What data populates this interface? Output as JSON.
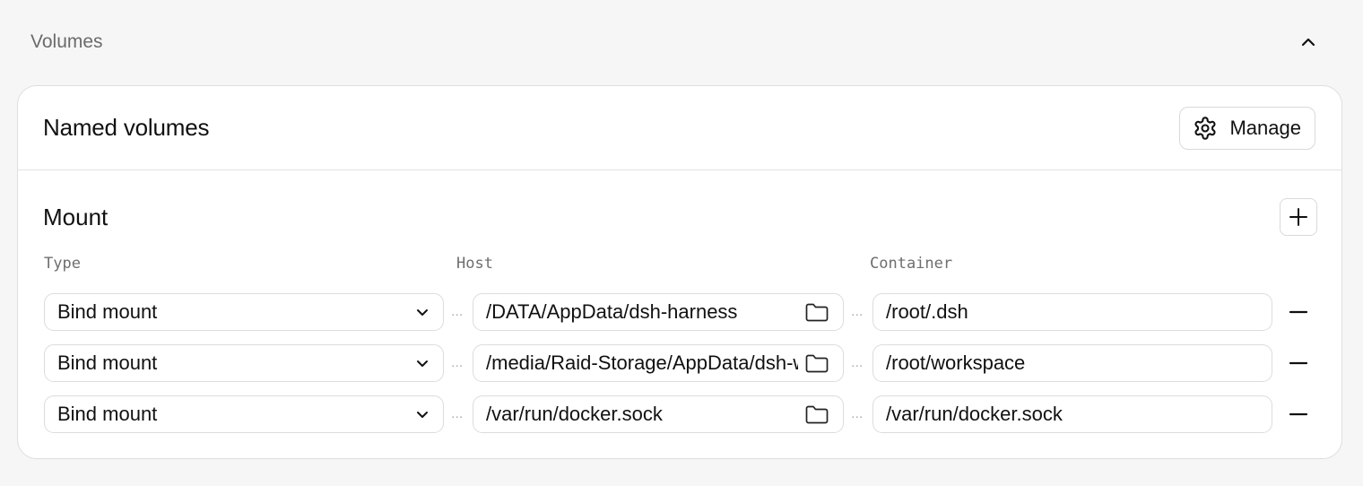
{
  "section": {
    "title": "Volumes"
  },
  "named_volumes": {
    "title": "Named volumes",
    "manage_label": "Manage"
  },
  "mount": {
    "title": "Mount",
    "columns": {
      "type": "Type",
      "host": "Host",
      "container": "Container"
    },
    "rows": [
      {
        "type": "Bind mount",
        "host": "/DATA/AppData/dsh-harness",
        "container": "/root/.dsh"
      },
      {
        "type": "Bind mount",
        "host": "/media/Raid-Storage/AppData/dsh-workspace",
        "container": "/root/workspace"
      },
      {
        "type": "Bind mount",
        "host": "/var/run/docker.sock",
        "container": "/var/run/docker.sock"
      }
    ],
    "separator": "..."
  },
  "colors": {
    "border": "#dcdcdc",
    "muted": "#6e6e6e",
    "background": "#f6f6f6"
  }
}
